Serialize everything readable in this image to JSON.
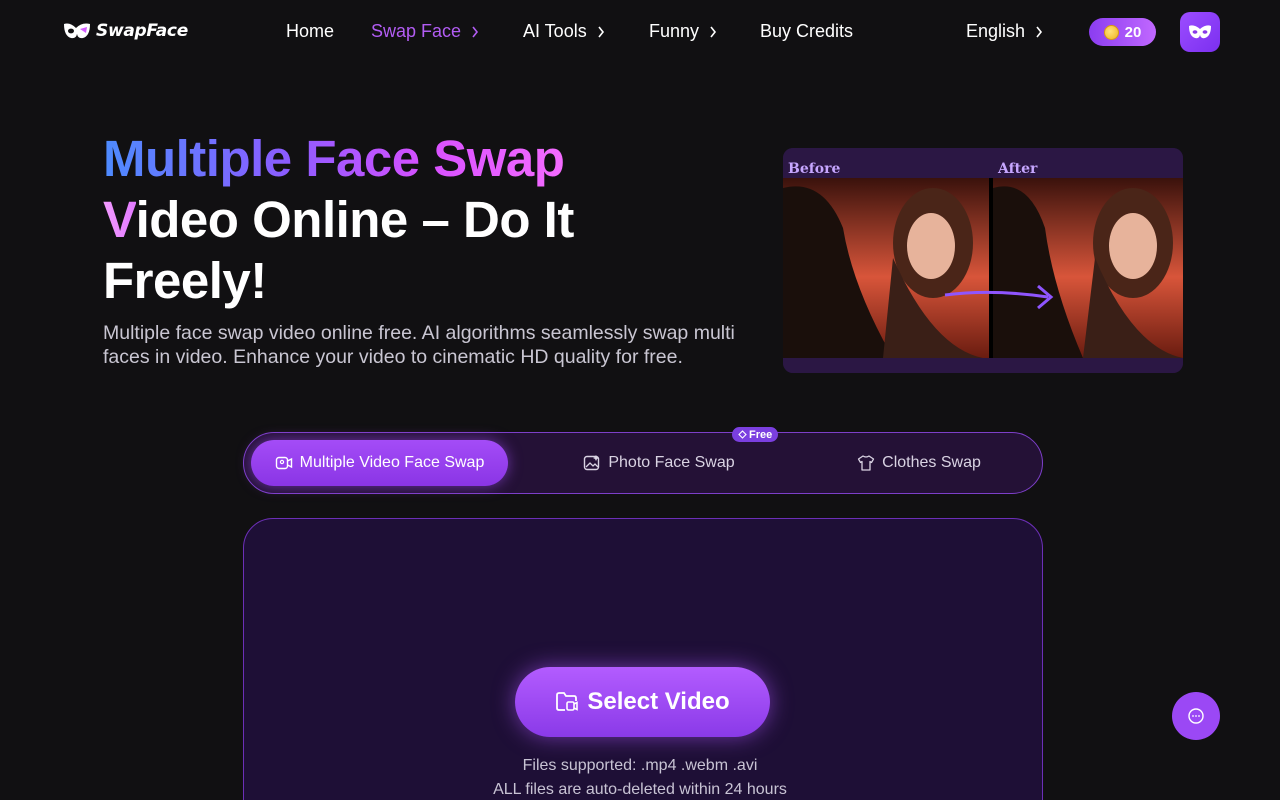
{
  "nav": {
    "logo_text": "SwapFace",
    "items": [
      {
        "label": "Home"
      },
      {
        "label": "Swap Face"
      },
      {
        "label": "AI Tools"
      },
      {
        "label": "Funny"
      },
      {
        "label": "Buy Credits"
      }
    ],
    "language": "English",
    "credits": "20"
  },
  "hero": {
    "title_line1_a": "Multiple Face Swap",
    "title_line2_a": "V",
    "title_line2_b": "ideo Online – Do It",
    "title_line3": "Freely!",
    "subtitle": "Multiple face swap video online free. AI algorithms seamlessly swap multi faces in video. Enhance your video to cinematic HD quality for free.",
    "preview_before": "Before",
    "preview_after": "After"
  },
  "tabs": [
    {
      "label": "Multiple Video Face Swap"
    },
    {
      "label": "Photo Face Swap"
    },
    {
      "label": "Clothes Swap"
    }
  ],
  "free_badge": "Free",
  "upload": {
    "button_label": "Select Video",
    "files_supported": "Files supported: .mp4 .webm .avi",
    "auto_delete": "ALL files are auto-deleted within 24 hours"
  },
  "colors": {
    "accent": "#9b48f5",
    "active_nav": "#b25cf3",
    "background": "#111012"
  }
}
